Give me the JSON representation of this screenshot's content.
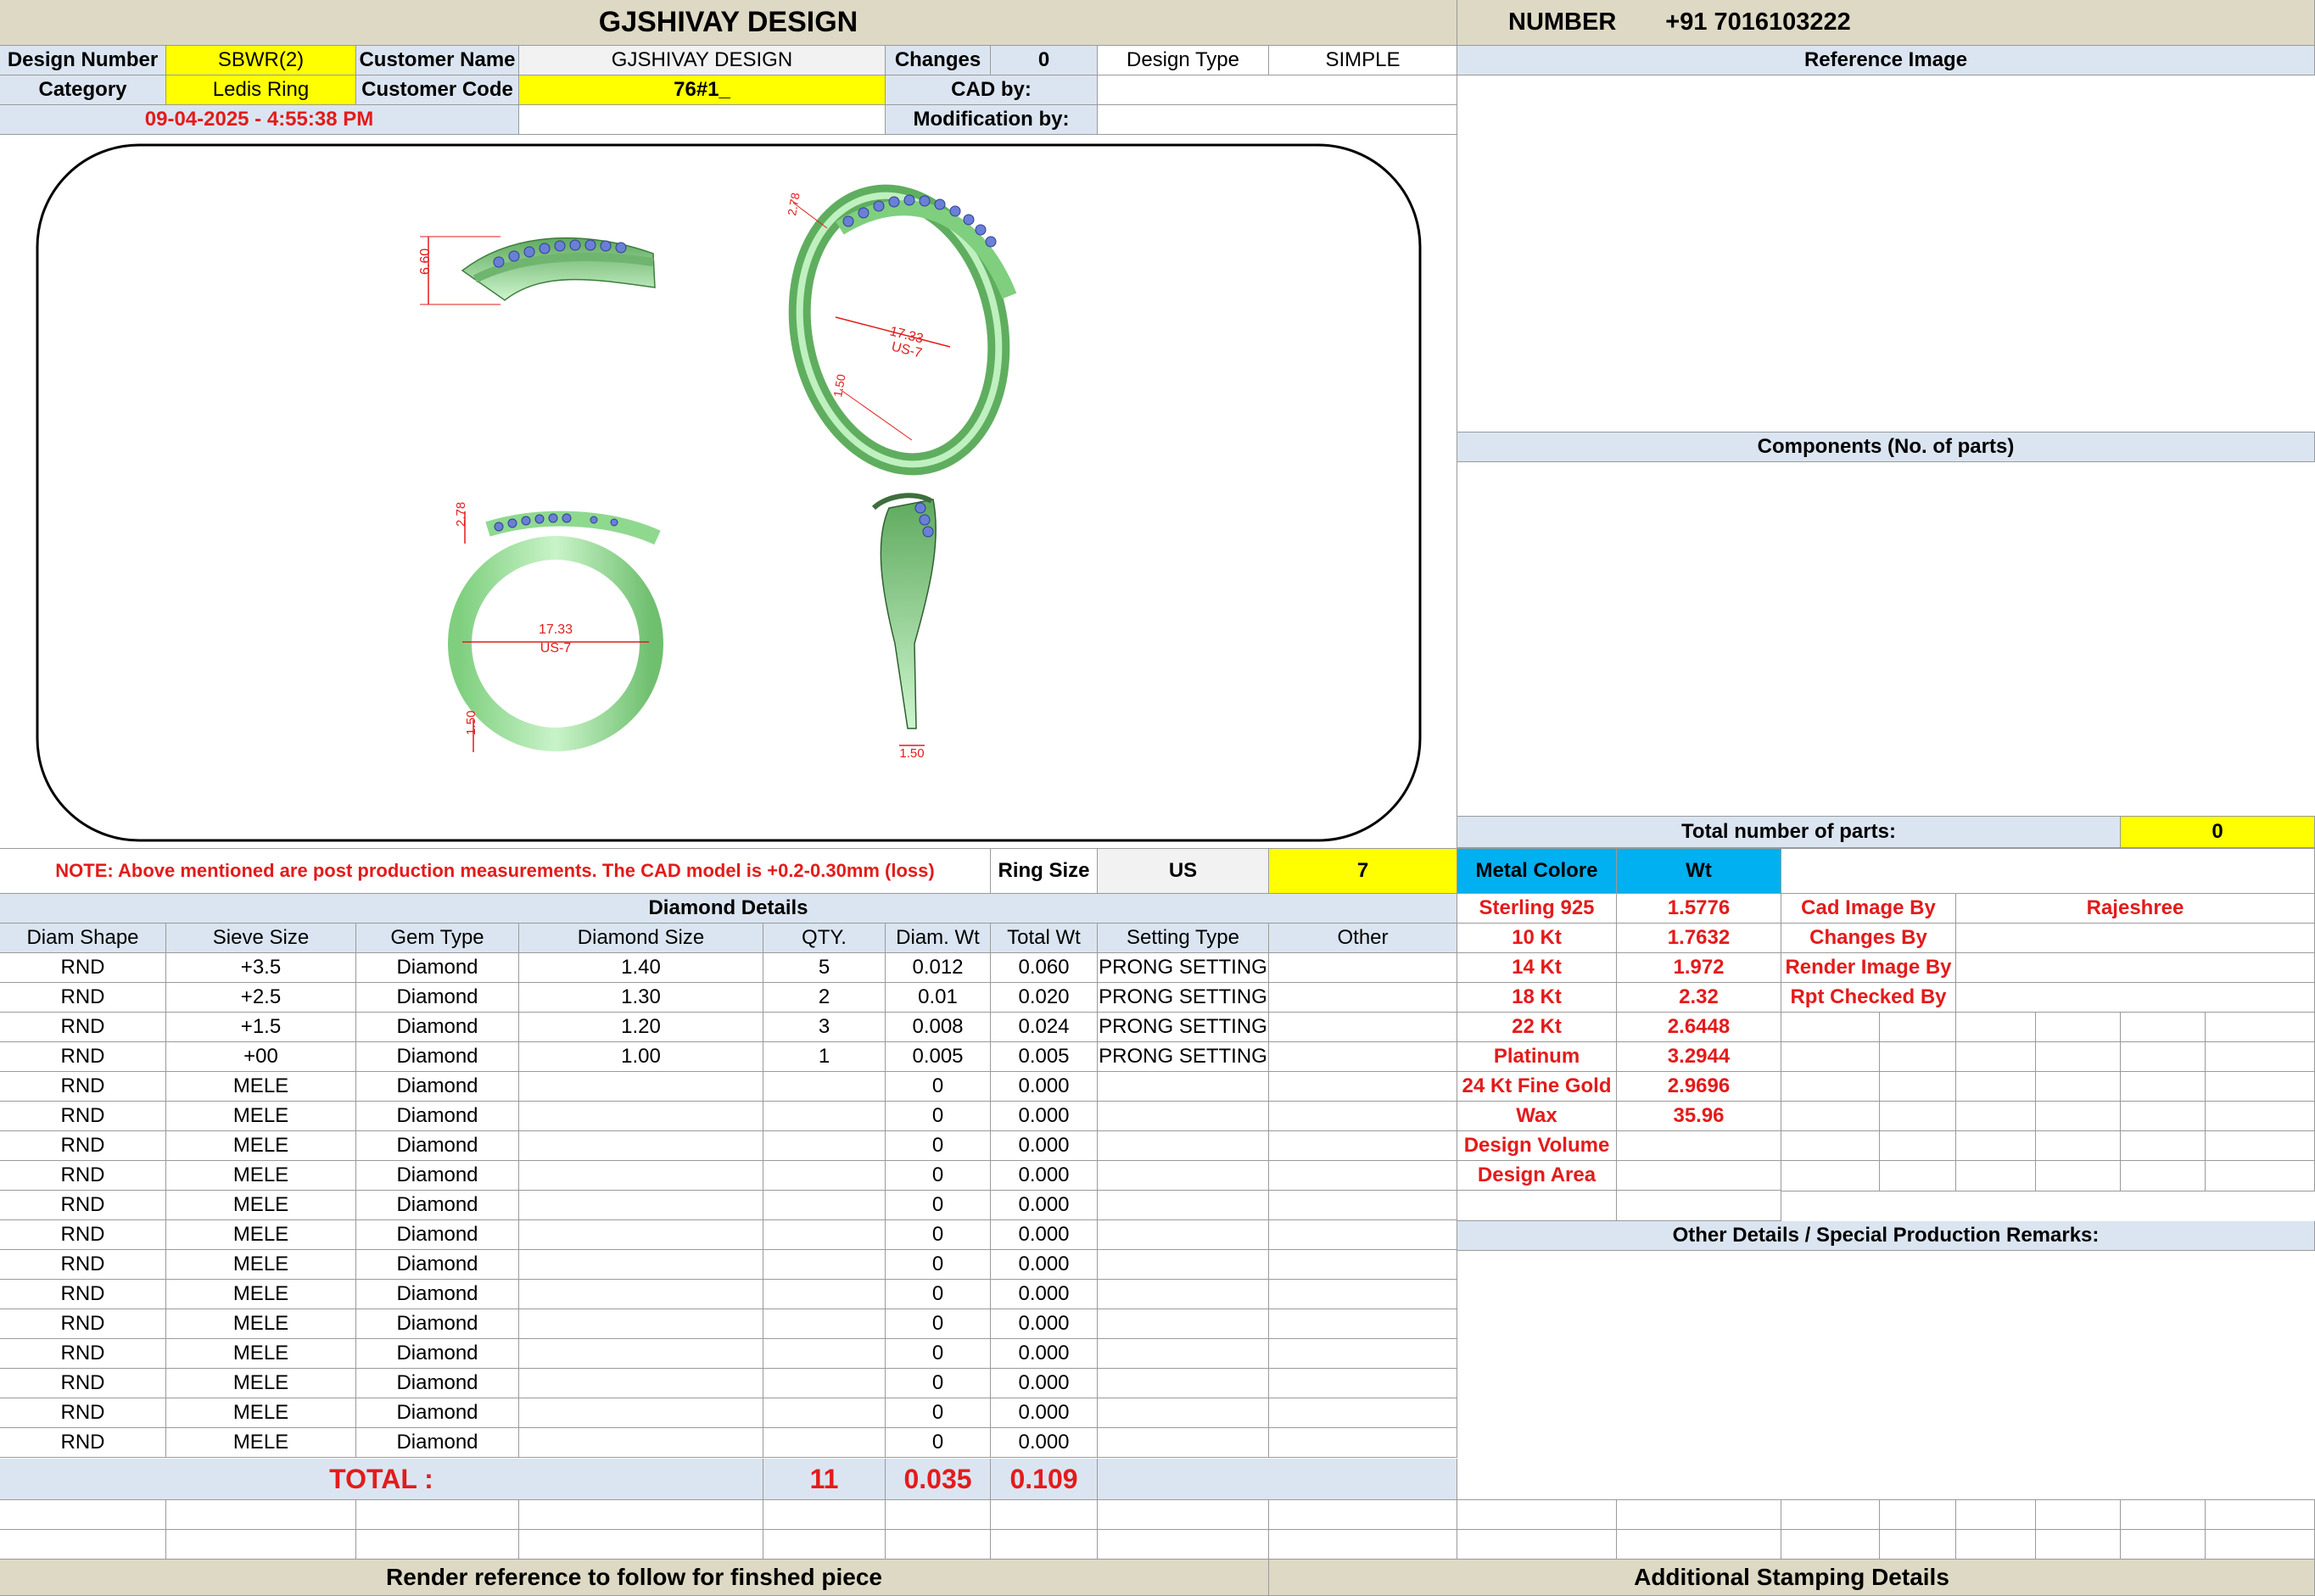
{
  "header": {
    "title": "GJSHIVAY DESIGN",
    "number_label": "NUMBER",
    "number_value": "+91 7016103222"
  },
  "info": {
    "design_number_label": "Design Number",
    "design_number": "SBWR(2)",
    "customer_name_label": "Customer Name",
    "customer_name": "GJSHIVAY DESIGN",
    "changes_label": "Changes",
    "changes_value": "0",
    "design_type_label": "Design Type",
    "design_type": "SIMPLE",
    "category_label": "Category",
    "category": "Ledis Ring",
    "customer_code_label": "Customer Code",
    "customer_code": "76#1_",
    "cad_by_label": "CAD by:",
    "cad_by": "",
    "modification_label": "Modification by:",
    "modification_by": "",
    "timestamp": "09-04-2025 - 4:55:38 PM"
  },
  "drawing": {
    "dim_height": "6.60",
    "dim_top": "2.78",
    "dim_inner": "17.33",
    "dim_size": "US-7",
    "dim_band": "1.50"
  },
  "right": {
    "reference_image": "Reference Image",
    "components": "Components (No. of parts)",
    "total_parts_label": "Total number of parts:",
    "total_parts_value": "0"
  },
  "note": {
    "text": "NOTE: Above mentioned are post production measurements. The CAD model is +0.2-0.30mm (loss)",
    "ring_size_label": "Ring Size",
    "ring_unit": "US",
    "ring_size": "7",
    "metal_colore_label": "Metal Colore",
    "wt_label": "Wt"
  },
  "diamond": {
    "section_title": "Diamond Details",
    "headers": [
      "Diam Shape",
      "Sieve Size",
      "Gem Type",
      "Diamond Size",
      "QTY.",
      "Diam. Wt",
      "Total Wt",
      "Setting Type",
      "Other"
    ],
    "rows": [
      [
        "RND",
        "+3.5",
        "Diamond",
        "1.40",
        "5",
        "0.012",
        "0.060",
        "PRONG SETTING",
        ""
      ],
      [
        "RND",
        "+2.5",
        "Diamond",
        "1.30",
        "2",
        "0.01",
        "0.020",
        "PRONG SETTING",
        ""
      ],
      [
        "RND",
        "+1.5",
        "Diamond",
        "1.20",
        "3",
        "0.008",
        "0.024",
        "PRONG SETTING",
        ""
      ],
      [
        "RND",
        "+00",
        "Diamond",
        "1.00",
        "1",
        "0.005",
        "0.005",
        "PRONG SETTING",
        ""
      ],
      [
        "RND",
        "MELE",
        "Diamond",
        "",
        "",
        "0",
        "0.000",
        "",
        ""
      ],
      [
        "RND",
        "MELE",
        "Diamond",
        "",
        "",
        "0",
        "0.000",
        "",
        ""
      ],
      [
        "RND",
        "MELE",
        "Diamond",
        "",
        "",
        "0",
        "0.000",
        "",
        ""
      ],
      [
        "RND",
        "MELE",
        "Diamond",
        "",
        "",
        "0",
        "0.000",
        "",
        ""
      ],
      [
        "RND",
        "MELE",
        "Diamond",
        "",
        "",
        "0",
        "0.000",
        "",
        ""
      ],
      [
        "RND",
        "MELE",
        "Diamond",
        "",
        "",
        "0",
        "0.000",
        "",
        ""
      ],
      [
        "RND",
        "MELE",
        "Diamond",
        "",
        "",
        "0",
        "0.000",
        "",
        ""
      ],
      [
        "RND",
        "MELE",
        "Diamond",
        "",
        "",
        "0",
        "0.000",
        "",
        ""
      ],
      [
        "RND",
        "MELE",
        "Diamond",
        "",
        "",
        "0",
        "0.000",
        "",
        ""
      ],
      [
        "RND",
        "MELE",
        "Diamond",
        "",
        "",
        "0",
        "0.000",
        "",
        ""
      ],
      [
        "RND",
        "MELE",
        "Diamond",
        "",
        "",
        "0",
        "0.000",
        "",
        ""
      ],
      [
        "RND",
        "MELE",
        "Diamond",
        "",
        "",
        "0",
        "0.000",
        "",
        ""
      ],
      [
        "RND",
        "MELE",
        "Diamond",
        "",
        "",
        "0",
        "0.000",
        "",
        ""
      ]
    ],
    "total_label": "TOTAL :",
    "total_qty": "11",
    "total_diam_wt": "0.035",
    "total_wt": "0.109"
  },
  "metals": [
    {
      "name": "Sterling 925",
      "wt": "1.5776"
    },
    {
      "name": "10 Kt",
      "wt": "1.7632"
    },
    {
      "name": "14 Kt",
      "wt": "1.972"
    },
    {
      "name": "18 Kt",
      "wt": "2.32"
    },
    {
      "name": "22 Kt",
      "wt": "2.6448"
    },
    {
      "name": "Platinum",
      "wt": "3.2944"
    },
    {
      "name": "24 Kt Fine Gold",
      "wt": "2.9696"
    },
    {
      "name": "Wax",
      "wt": "35.96"
    },
    {
      "name": "Design Volume",
      "wt": ""
    },
    {
      "name": "Design Area",
      "wt": ""
    }
  ],
  "credits": [
    {
      "label": "Cad Image By",
      "value": "Rajeshree"
    },
    {
      "label": "Changes By",
      "value": ""
    },
    {
      "label": "Render Image By",
      "value": ""
    },
    {
      "label": "Rpt Checked By",
      "value": ""
    }
  ],
  "remarks_title": "Other Details / Special Production Remarks:",
  "footer": {
    "render_reference": "Render reference to follow for finshed piece",
    "stamping": "Additional Stamping Details"
  },
  "colors": {
    "header_tan": "#ddd9c4",
    "label_blue": "#dbe5f1",
    "highlight_yellow": "#ffff00",
    "accent_cyan": "#00b0f0",
    "text_red": "#e31b1b",
    "ring_green": "#a8e8a8"
  }
}
